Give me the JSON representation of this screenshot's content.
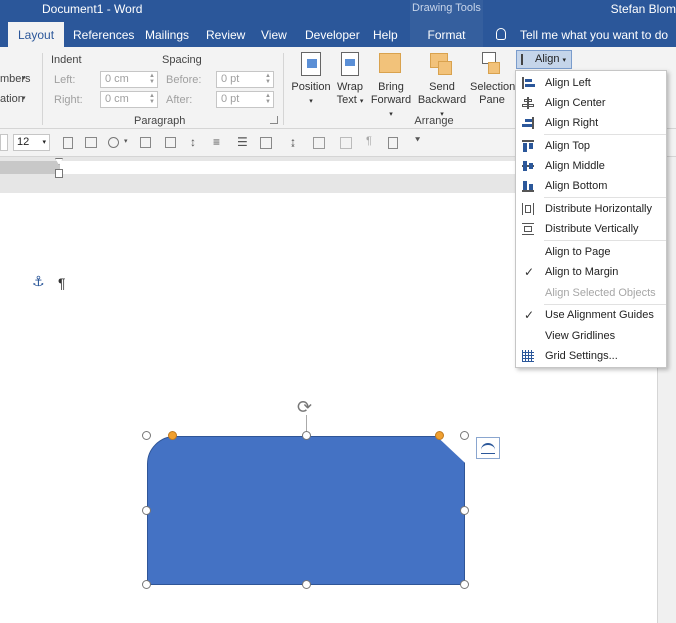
{
  "window": {
    "title": "Document1  -  Word",
    "context_tab_group": "Drawing Tools",
    "user": "Stefan Blom"
  },
  "tabs": [
    "Layout",
    "References",
    "Mailings",
    "Review",
    "View",
    "Developer",
    "Help",
    "Format"
  ],
  "active_tab": "Layout",
  "tell_me": "Tell me what you want to do",
  "ribbon": {
    "left_partial": [
      "mbers",
      "ation"
    ],
    "indent": {
      "title": "Indent",
      "left_label": "Left:",
      "left_value": "0 cm",
      "right_label": "Right:",
      "right_value": "0 cm"
    },
    "spacing": {
      "title": "Spacing",
      "before_label": "Before:",
      "before_value": "0 pt",
      "after_label": "After:",
      "after_value": "0 pt"
    },
    "paragraph_group": "Paragraph",
    "arrange_group": "Arrange",
    "buttons": {
      "position": "Position",
      "wrap_text_1": "Wrap",
      "wrap_text_2": "Text",
      "bring_forward_1": "Bring",
      "bring_forward_2": "Forward",
      "send_backward_1": "Send",
      "send_backward_2": "Backward",
      "selection_pane_1": "Selection",
      "selection_pane_2": "Pane",
      "align": "Align"
    }
  },
  "toolbar2": {
    "font_size": "12"
  },
  "align_menu": {
    "items": [
      {
        "label": "Align Left",
        "icon": "align-left-icon"
      },
      {
        "label": "Align Center",
        "icon": "align-center-icon"
      },
      {
        "label": "Align Right",
        "icon": "align-right-icon"
      },
      {
        "label": "Align Top",
        "icon": "align-top-icon"
      },
      {
        "label": "Align Middle",
        "icon": "align-middle-icon"
      },
      {
        "label": "Align Bottom",
        "icon": "align-bottom-icon"
      },
      {
        "label": "Distribute Horizontally",
        "icon": "distribute-horizontally-icon"
      },
      {
        "label": "Distribute Vertically",
        "icon": "distribute-vertically-icon"
      },
      {
        "label": "Align to Page",
        "checked": false
      },
      {
        "label": "Align to Margin",
        "checked": true
      },
      {
        "label": "Align Selected Objects",
        "disabled": true
      },
      {
        "label": "Use Alignment Guides",
        "checked": true
      },
      {
        "label": "View Gridlines",
        "checked": false
      },
      {
        "label": "Grid Settings...",
        "icon": "grid-icon"
      }
    ]
  },
  "document": {
    "pilcrow": "¶"
  },
  "colors": {
    "word_blue": "#2b579a",
    "shape_fill": "#4472c4",
    "adjust_handle": "#f0a030",
    "align_button_bg": "#c5d5ea"
  }
}
